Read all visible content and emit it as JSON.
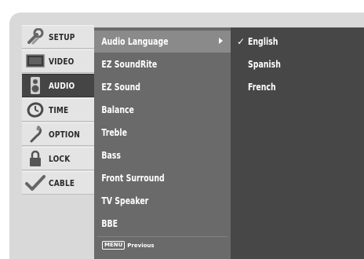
{
  "sidebar": {
    "items": [
      {
        "label": "SETUP",
        "icon": "setup-icon"
      },
      {
        "label": "VIDEO",
        "icon": "video-icon"
      },
      {
        "label": "AUDIO",
        "icon": "audio-icon"
      },
      {
        "label": "TIME",
        "icon": "time-icon"
      },
      {
        "label": "OPTION",
        "icon": "option-icon"
      },
      {
        "label": "LOCK",
        "icon": "lock-icon"
      },
      {
        "label": "CABLE",
        "icon": "cable-icon"
      }
    ]
  },
  "menu": {
    "items": [
      {
        "label": "Audio Language"
      },
      {
        "label": "EZ SoundRite"
      },
      {
        "label": "EZ Sound"
      },
      {
        "label": "Balance"
      },
      {
        "label": "Treble"
      },
      {
        "label": "Bass"
      },
      {
        "label": "Front Surround"
      },
      {
        "label": "TV Speaker"
      },
      {
        "label": "BBE"
      }
    ]
  },
  "submenu": {
    "items": [
      {
        "label": "English",
        "check": "✓"
      },
      {
        "label": "Spanish",
        "check": ""
      },
      {
        "label": "French",
        "check": ""
      }
    ]
  },
  "footer": {
    "key": "MENU",
    "label": "Previous"
  }
}
